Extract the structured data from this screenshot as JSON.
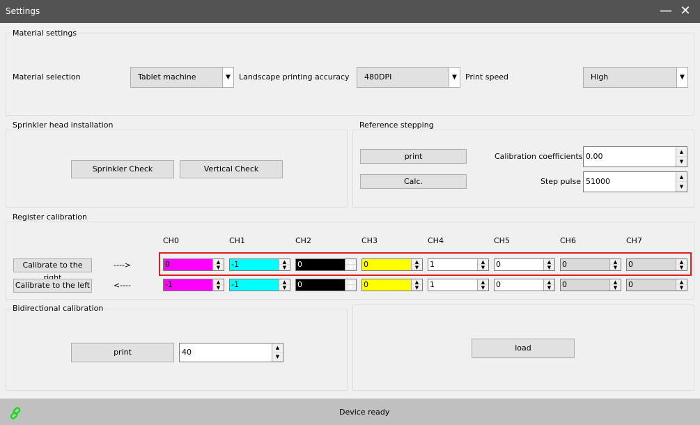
{
  "window": {
    "title": "Settings",
    "minimize": "—",
    "close": "✕"
  },
  "material": {
    "legend": "Material settings",
    "material_label": "Material selection",
    "material_value": "Tablet machine",
    "accuracy_label": "Landscape printing accuracy",
    "accuracy_value": "480DPI",
    "speed_label": "Print speed",
    "speed_value": "High"
  },
  "sprinkler": {
    "legend": "Sprinkler head installation",
    "check": "Sprinkler Check",
    "vertical": "Vertical Check"
  },
  "reference": {
    "legend": "Reference stepping",
    "print": "print",
    "calc": "Calc.",
    "coef_label": "Calibration coefficients",
    "coef_value": "0.00",
    "pulse_label": "Step pulse",
    "pulse_value": "51000"
  },
  "register": {
    "legend": "Register calibration",
    "channels": [
      "CH0",
      "CH1",
      "CH2",
      "CH3",
      "CH4",
      "CH5",
      "CH6",
      "CH7"
    ],
    "channel_colors": [
      "#ff00ff",
      "#00ffff",
      "#000000",
      "#ffff00",
      "#ffffff",
      "#ffffff",
      "#d9d9d9",
      "#d9d9d9"
    ],
    "right_label": "Calibrate to the right",
    "right_arrow": "---->",
    "left_label": "Calibrate to the left",
    "left_arrow": "<----",
    "right_values": [
      "0",
      "-1",
      "0",
      "0",
      "1",
      "0",
      "0",
      "0"
    ],
    "left_values": [
      "-1",
      "-1",
      "0",
      "0",
      "1",
      "0",
      "0",
      "0"
    ],
    "highlight_color": "#e02020"
  },
  "bidirectional": {
    "legend": "Bidirectional calibration",
    "print": "print",
    "value": "40"
  },
  "load": {
    "label": "load"
  },
  "status": {
    "text": "Device ready",
    "icon": "link-icon",
    "icon_color": "#00e000"
  }
}
